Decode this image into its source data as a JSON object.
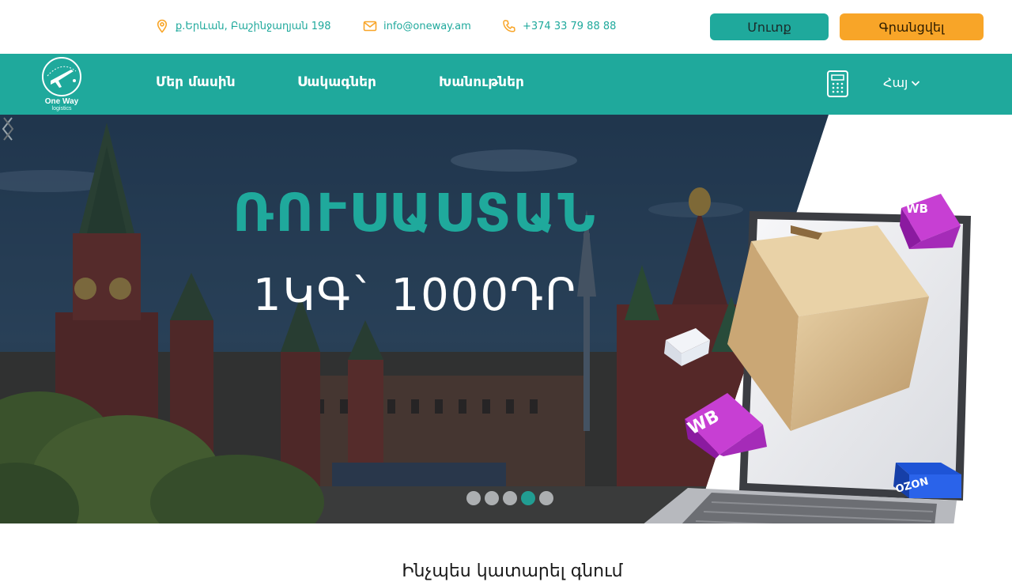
{
  "contacts": {
    "address": "ք.Երևան, Բաշինջաղյան 198",
    "email": "info@oneway.am",
    "phone": "+374 33 79 88 88"
  },
  "auth": {
    "login_label": "Մուտք",
    "register_label": "Գրանցվել"
  },
  "logo": {
    "name": "One Way",
    "sub": "logistics"
  },
  "nav": {
    "items": [
      {
        "label": "Մեր մասին"
      },
      {
        "label": "Սակագներ"
      },
      {
        "label": "Խանութներ"
      }
    ],
    "language": "Հայ"
  },
  "hero": {
    "title": "ՌՈՒՍԱՍՏԱՆ",
    "price": "1ԿԳ` 1000ԴՐ",
    "badges": [
      "WB",
      "WB",
      "OZON"
    ],
    "slides_count": 5,
    "active_slide": 4
  },
  "section": {
    "heading": "Ինչպես կատարել գնում"
  },
  "colors": {
    "brand": "#1fa99c",
    "accent": "#f8a528"
  }
}
